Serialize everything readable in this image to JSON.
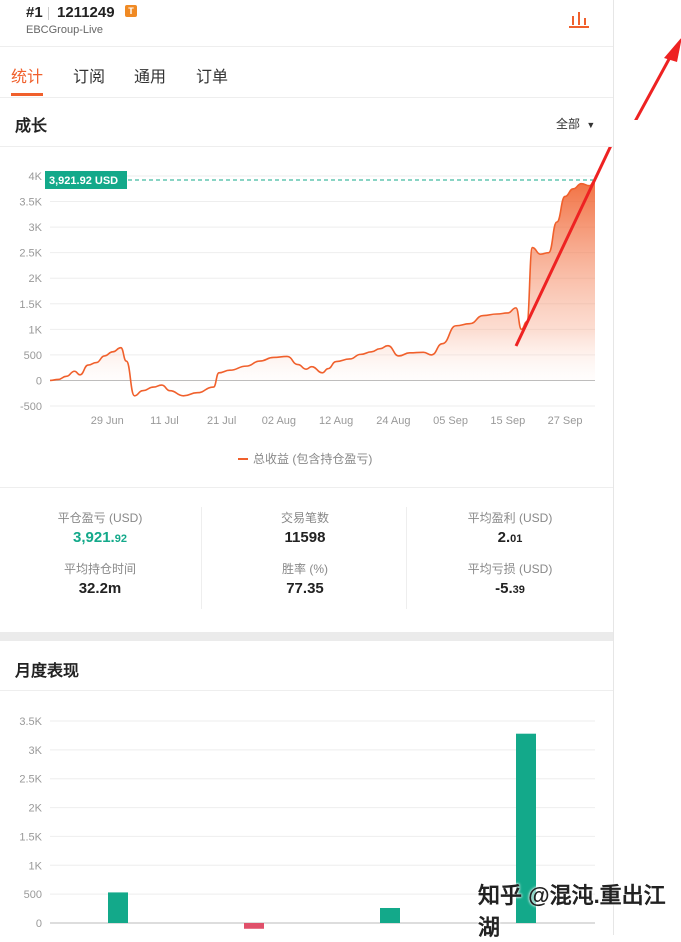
{
  "header": {
    "rank": "#1",
    "account": "1211249",
    "badge": "T",
    "server": "EBCGroup-Live"
  },
  "tabs": [
    {
      "label": "统计",
      "active": true
    },
    {
      "label": "订阅",
      "active": false
    },
    {
      "label": "通用",
      "active": false
    },
    {
      "label": "订单",
      "active": false
    }
  ],
  "growth": {
    "title": "成长",
    "filter": "全部",
    "current_label": "3,921.92 USD",
    "legend": "总收益 (包含持仓盈亏)"
  },
  "stats": {
    "closed_pnl_label": "平仓盈亏 (USD)",
    "closed_pnl_main": "3,921.",
    "closed_pnl_dec": "92",
    "trades_label": "交易笔数",
    "trades": "11598",
    "avg_profit_label": "平均盈利 (USD)",
    "avg_profit_main": "2.",
    "avg_profit_dec": "01",
    "avg_hold_label": "平均持仓时间",
    "avg_hold": "32.2m",
    "winrate_label": "胜率 (%)",
    "winrate": "77.35",
    "avg_loss_label": "平均亏损 (USD)",
    "avg_loss_main": "-5.",
    "avg_loss_dec": "39"
  },
  "monthly": {
    "title": "月度表现"
  },
  "watermark": "知乎 @混沌.重出江湖",
  "colors": {
    "accent": "#f0602c",
    "profit": "#13a98a",
    "loss": "#e0506a",
    "arrow": "#ee2222"
  },
  "chart_data": [
    {
      "type": "area",
      "ylim": [
        -500,
        4000
      ],
      "yticks": [
        {
          "v": 4000,
          "label": "4K"
        },
        {
          "v": 3500,
          "label": "3.5K"
        },
        {
          "v": 3000,
          "label": "3K"
        },
        {
          "v": 2500,
          "label": "2.5K"
        },
        {
          "v": 2000,
          "label": "2K"
        },
        {
          "v": 1500,
          "label": "1.5K"
        },
        {
          "v": 1000,
          "label": "1K"
        },
        {
          "v": 500,
          "label": "500"
        },
        {
          "v": 0,
          "label": "0"
        },
        {
          "v": -500,
          "label": "-500"
        }
      ],
      "xticks": [
        {
          "t": 0.105,
          "label": "29 Jun"
        },
        {
          "t": 0.21,
          "label": "11 Jul"
        },
        {
          "t": 0.315,
          "label": "21 Jul"
        },
        {
          "t": 0.42,
          "label": "02 Aug"
        },
        {
          "t": 0.525,
          "label": "12 Aug"
        },
        {
          "t": 0.63,
          "label": "24 Aug"
        },
        {
          "t": 0.735,
          "label": "05 Sep"
        },
        {
          "t": 0.84,
          "label": "15 Sep"
        },
        {
          "t": 0.945,
          "label": "27 Sep"
        }
      ],
      "series": [
        {
          "name": "总收益 (包含持仓盈亏)",
          "values": [
            [
              0.0,
              0
            ],
            [
              0.015,
              20
            ],
            [
              0.03,
              80
            ],
            [
              0.045,
              180
            ],
            [
              0.055,
              110
            ],
            [
              0.07,
              300
            ],
            [
              0.085,
              350
            ],
            [
              0.1,
              480
            ],
            [
              0.115,
              560
            ],
            [
              0.13,
              640
            ],
            [
              0.14,
              380
            ],
            [
              0.155,
              -300
            ],
            [
              0.17,
              -200
            ],
            [
              0.19,
              -130
            ],
            [
              0.205,
              -90
            ],
            [
              0.22,
              -200
            ],
            [
              0.245,
              -300
            ],
            [
              0.27,
              -240
            ],
            [
              0.3,
              -130
            ],
            [
              0.31,
              150
            ],
            [
              0.33,
              200
            ],
            [
              0.36,
              280
            ],
            [
              0.385,
              380
            ],
            [
              0.41,
              450
            ],
            [
              0.435,
              470
            ],
            [
              0.455,
              310
            ],
            [
              0.47,
              220
            ],
            [
              0.48,
              270
            ],
            [
              0.5,
              150
            ],
            [
              0.51,
              230
            ],
            [
              0.525,
              370
            ],
            [
              0.55,
              420
            ],
            [
              0.57,
              510
            ],
            [
              0.59,
              560
            ],
            [
              0.605,
              620
            ],
            [
              0.62,
              680
            ],
            [
              0.64,
              480
            ],
            [
              0.66,
              540
            ],
            [
              0.685,
              550
            ],
            [
              0.7,
              500
            ],
            [
              0.72,
              720
            ],
            [
              0.745,
              1070
            ],
            [
              0.77,
              1110
            ],
            [
              0.795,
              1270
            ],
            [
              0.82,
              1300
            ],
            [
              0.84,
              1320
            ],
            [
              0.855,
              1420
            ],
            [
              0.865,
              1000
            ],
            [
              0.875,
              1150
            ],
            [
              0.885,
              2600
            ],
            [
              0.9,
              2470
            ],
            [
              0.915,
              2500
            ],
            [
              0.93,
              3100
            ],
            [
              0.945,
              3600
            ],
            [
              0.96,
              3750
            ],
            [
              0.975,
              3850
            ],
            [
              0.99,
              3810
            ],
            [
              1.0,
              3921.92
            ]
          ]
        }
      ]
    },
    {
      "type": "bar",
      "ylim": [
        0,
        3500
      ],
      "yticks": [
        {
          "v": 3500,
          "label": "3.5K"
        },
        {
          "v": 3000,
          "label": "3K"
        },
        {
          "v": 2500,
          "label": "2.5K"
        },
        {
          "v": 2000,
          "label": "2K"
        },
        {
          "v": 1500,
          "label": "1.5K"
        },
        {
          "v": 1000,
          "label": "1K"
        },
        {
          "v": 500,
          "label": "500"
        },
        {
          "v": 0,
          "label": "0"
        }
      ],
      "categories": [
        "",
        "",
        "",
        ""
      ],
      "values": [
        530,
        -100,
        260,
        3280
      ]
    }
  ]
}
